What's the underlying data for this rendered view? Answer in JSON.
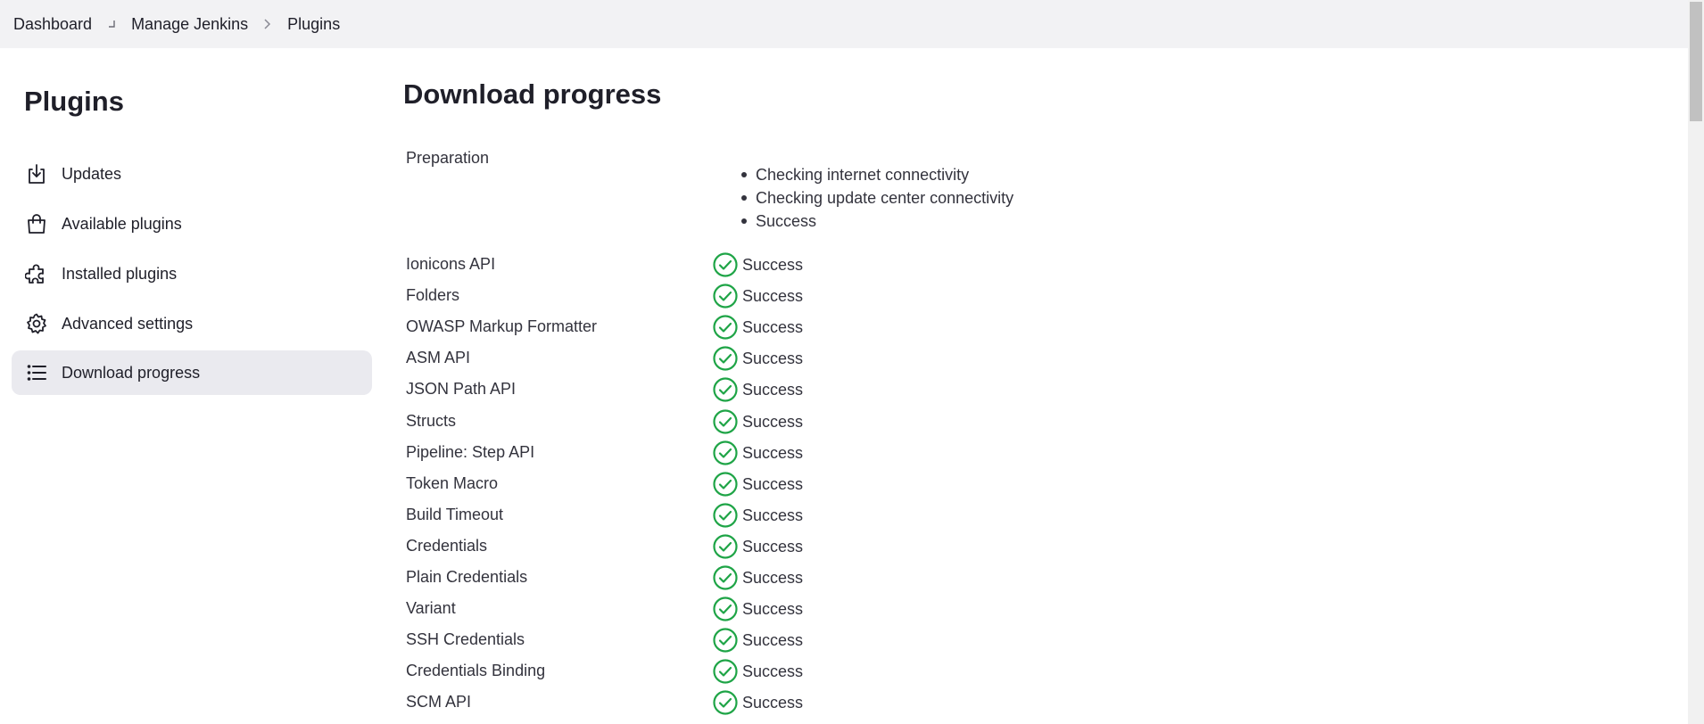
{
  "breadcrumb": {
    "items": [
      "Dashboard",
      "Manage Jenkins",
      "Plugins"
    ]
  },
  "sidebar": {
    "title": "Plugins",
    "items": [
      {
        "label": "Updates",
        "icon": "download-icon"
      },
      {
        "label": "Available plugins",
        "icon": "shopping-bag-icon"
      },
      {
        "label": "Installed plugins",
        "icon": "puzzle-icon"
      },
      {
        "label": "Advanced settings",
        "icon": "gear-icon"
      },
      {
        "label": "Download progress",
        "icon": "list-icon",
        "active": true
      }
    ]
  },
  "main": {
    "title": "Download progress",
    "preparation": {
      "label": "Preparation",
      "steps": [
        "Checking internet connectivity",
        "Checking update center connectivity",
        "Success"
      ]
    },
    "plugins": [
      {
        "name": "Ionicons API",
        "status": "Success"
      },
      {
        "name": "Folders",
        "status": "Success"
      },
      {
        "name": "OWASP Markup Formatter",
        "status": "Success"
      },
      {
        "name": "ASM API",
        "status": "Success"
      },
      {
        "name": "JSON Path API",
        "status": "Success"
      },
      {
        "name": "Structs",
        "status": "Success"
      },
      {
        "name": "Pipeline: Step API",
        "status": "Success"
      },
      {
        "name": "Token Macro",
        "status": "Success"
      },
      {
        "name": "Build Timeout",
        "status": "Success"
      },
      {
        "name": "Credentials",
        "status": "Success"
      },
      {
        "name": "Plain Credentials",
        "status": "Success"
      },
      {
        "name": "Variant",
        "status": "Success"
      },
      {
        "name": "SSH Credentials",
        "status": "Success"
      },
      {
        "name": "Credentials Binding",
        "status": "Success"
      },
      {
        "name": "SCM API",
        "status": "Success"
      }
    ]
  },
  "colors": {
    "success": "#1ea446",
    "breadcrumb_bg": "#f2f2f4",
    "active_item_bg": "#eaeaef"
  }
}
